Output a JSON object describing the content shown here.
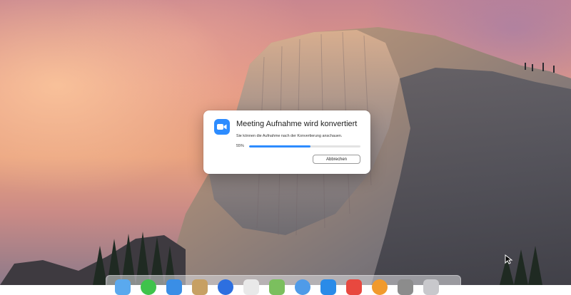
{
  "dialog": {
    "title": "Meeting Aufnahme wird konvertiert",
    "message": "Sie können die Aufnahme nach der Konvertierung anschauen.",
    "progress_label": "55%",
    "progress_value": 0.55,
    "cancel_label": "Abbrechen",
    "icon": "zoom-video-icon"
  },
  "colors": {
    "accent": "#2d8cff",
    "dialog_bg": "#ffffff"
  },
  "dock": {
    "items": [
      {
        "icon": "finder-icon",
        "color": "#5aa9ee"
      },
      {
        "icon": "messages-icon",
        "color": "#3fc34b"
      },
      {
        "icon": "safari-icon",
        "color": "#3a8ee6"
      },
      {
        "icon": "notes-icon",
        "color": "#c7a063"
      },
      {
        "icon": "zoom-icon",
        "color": "#2d6fe0"
      },
      {
        "icon": "preview-icon",
        "color": "#e9e9e9"
      },
      {
        "icon": "photos-icon",
        "color": "#7bbf5e"
      },
      {
        "icon": "mail-icon",
        "color": "#4f9be8"
      },
      {
        "icon": "app-store-icon",
        "color": "#2a8be8"
      },
      {
        "icon": "music-icon",
        "color": "#e8483f"
      },
      {
        "icon": "books-icon",
        "color": "#f19a2c"
      },
      {
        "icon": "settings-icon",
        "color": "#8c8c8c"
      },
      {
        "icon": "trash-icon",
        "color": "#c8c8cc"
      }
    ]
  }
}
